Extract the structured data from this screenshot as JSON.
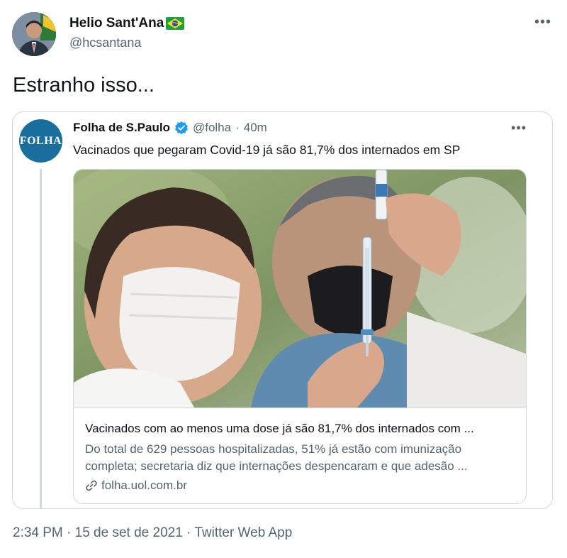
{
  "author": {
    "name": "Helio Sant'Ana",
    "handle": "@hcsantana",
    "flag_icon": "brazil-flag-icon",
    "avatar_icon": "profile-photo"
  },
  "tweet": {
    "text": "Estranho isso...",
    "more_icon": "more-options-icon"
  },
  "quoted": {
    "avatar_text": "FOLHA",
    "name": "Folha de S.Paulo",
    "verified_icon": "verified-badge-icon",
    "handle": "@folha",
    "separator": "·",
    "time": "40m",
    "text": "Vacinados que pegaram Covid-19 já são 81,7% dos internados em SP",
    "card": {
      "image_icon": "vaccination-photo",
      "title": "Vacinados com ao menos uma dose já são 81,7% dos internados com ...",
      "description": "Do total de 629 pessoas hospitalizadas, 51% já estão com imunização completa; secretaria diz que internações despencaram e que adesão ...",
      "link_icon": "link-icon",
      "domain": "folha.uol.com.br"
    }
  },
  "footer": {
    "meta": "2:34 PM · 15 de set de 2021 · Twitter Web App"
  },
  "colors": {
    "text_primary": "#0f1419",
    "text_secondary": "#536471",
    "border": "#cfd9de",
    "verified_blue": "#1d9bf0",
    "folha_blue": "#1a6e9e"
  }
}
